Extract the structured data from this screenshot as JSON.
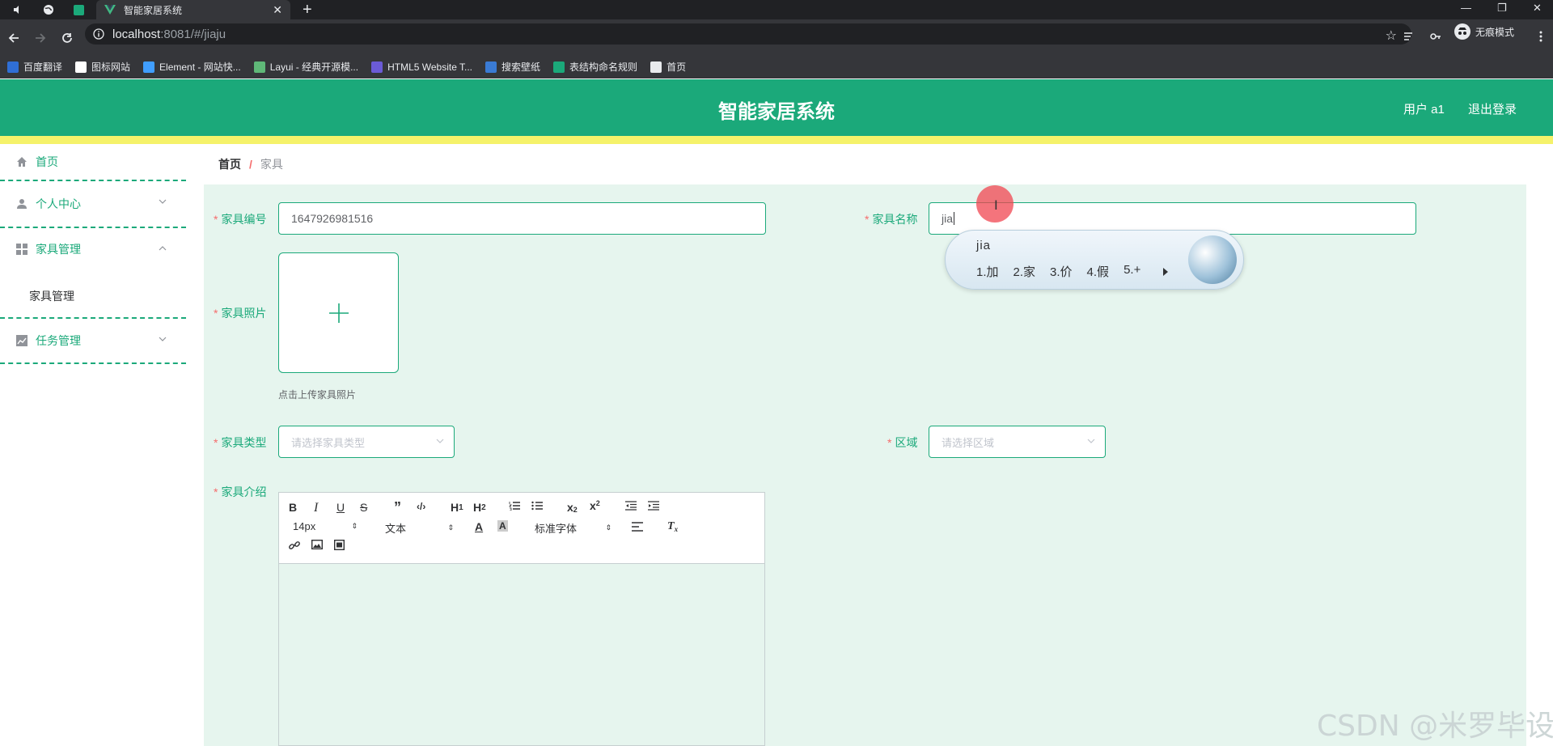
{
  "browser": {
    "tab_title": "智能家居系统",
    "url_host": "localhost",
    "url_rest": ":8081/#/jiaju",
    "incognito_label": "无痕模式",
    "bookmarks": [
      {
        "label": "百度翻译",
        "color": "#2f6fd6",
        "icon": "translate-icon"
      },
      {
        "label": "图标网站",
        "color": "#ffffff",
        "icon": "flag-icon"
      },
      {
        "label": "Element - 网站快...",
        "color": "#409eff",
        "icon": "element-icon"
      },
      {
        "label": "Layui - 经典开源模...",
        "color": "#5fb878",
        "icon": "layui-icon"
      },
      {
        "label": "HTML5 Website T...",
        "color": "#6b5bd6",
        "icon": "html5-icon"
      },
      {
        "label": "搜索壁纸",
        "color": "#3a7bd5",
        "icon": "wallpaper-icon"
      },
      {
        "label": "表结构命名规则",
        "color": "#1ba97a",
        "icon": "table-icon"
      },
      {
        "label": "首页",
        "color": "#e8eaed",
        "icon": "globe-icon"
      }
    ]
  },
  "header": {
    "title": "智能家居系统",
    "user": "用户 a1",
    "logout": "退出登录",
    "brand_color": "#1ba97a",
    "stripe_color": "#f5f26a"
  },
  "sidebar": {
    "items": [
      {
        "label": "首页",
        "icon": "home-icon"
      },
      {
        "label": "个人中心",
        "icon": "user-icon"
      },
      {
        "label": "家具管理",
        "icon": "grid-icon",
        "expanded": true
      },
      {
        "label": "任务管理",
        "icon": "chart-icon"
      }
    ],
    "sub_items": [
      "家具管理"
    ]
  },
  "breadcrumb": {
    "home": "首页",
    "separator": "/",
    "current": "家具"
  },
  "form": {
    "code_label": "家具编号",
    "code_value": "1647926981516",
    "name_label": "家具名称",
    "name_value": "jia",
    "photo_label": "家具照片",
    "photo_tip": "点击上传家具照片",
    "type_label": "家具类型",
    "type_placeholder": "请选择家具类型",
    "area_label": "区域",
    "area_placeholder": "请选择区域",
    "intro_label": "家具介绍",
    "required_mark": "*"
  },
  "editor": {
    "size_value": "14px",
    "header_value": "文本",
    "font_value": "标准字体"
  },
  "ime": {
    "composition": "jia",
    "candidates": [
      "1.加",
      "2.家",
      "3.价",
      "4.假",
      "5.+"
    ]
  },
  "watermark": "CSDN @米罗毕设"
}
